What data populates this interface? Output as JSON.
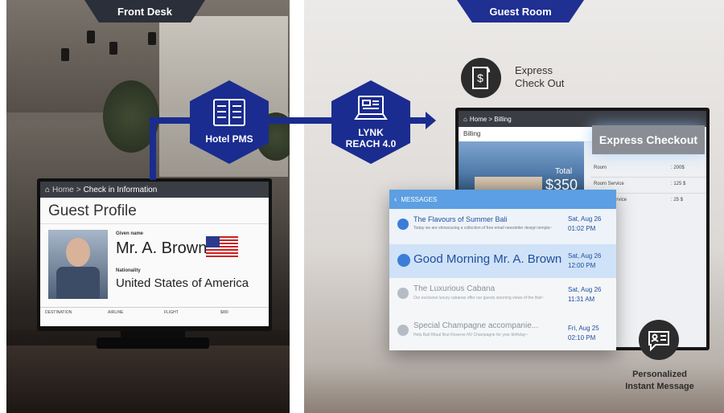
{
  "headers": {
    "front_desk": "Front Desk",
    "guest_room": "Guest Room"
  },
  "hexagons": {
    "hotel_pms": "Hotel PMS",
    "lynk_line1": "LYNK",
    "lynk_line2": "REACH 4.0",
    "pms_icon": "server-icon",
    "lynk_icon": "laptop-icon"
  },
  "front_desk_screen": {
    "breadcrumb_home": "Home",
    "breadcrumb_sep": ">",
    "breadcrumb_page": "Check in Information",
    "title": "Guest Profile",
    "given_name_label": "Given name",
    "given_name": "Mr. A. Brown",
    "nationality_label": "Nationality",
    "nationality": "United States of America",
    "table_headers": [
      "DESTINATION",
      "AIRLINE",
      "FLIGHT",
      "$/80"
    ]
  },
  "features": {
    "express_line1": "Express",
    "express_line2": "Check Out",
    "express_icon": "receipt-dollar-icon",
    "message_line1": "Personalized",
    "message_line2": "Instant Message",
    "message_icon": "chat-person-icon"
  },
  "billing_screen": {
    "breadcrumb": "Home > Billing",
    "tab": "Billing",
    "panel_title": "Express Checkout",
    "total_label": "Total",
    "total_value": "$350",
    "rows": [
      {
        "label": "Room",
        "value": ": 200$"
      },
      {
        "label": "Room Service",
        "value": ": 125 $"
      },
      {
        "label": "service",
        "value": ": 25 $"
      }
    ]
  },
  "messages_panel": {
    "header": "MESSAGES",
    "items": [
      {
        "title": "The Flavours of Summer Bali",
        "preview": "Today we are showcasing a collection of free email newsletter design templa~",
        "date": "Sat, Aug 26",
        "time": "01:02 PM",
        "state": "unread"
      },
      {
        "title": "Good Morning Mr. A. Brown",
        "preview": "",
        "date": "Sat, Aug 26",
        "time": "12:00 PM",
        "state": "selected"
      },
      {
        "title": "The Luxurious Cabana",
        "preview": "Our exclusive luxury cabanas offer our guests stunning views of the Bali~",
        "date": "Sat, Aug 26",
        "time": "11:31 AM",
        "state": "read"
      },
      {
        "title": "Special Champagne accompanie...",
        "preview": "Help Bali Ritual Brut Reserve NV Champagne for your birthday~",
        "date": "Fri, Aug 25",
        "time": "02:10 PM",
        "state": "read"
      }
    ]
  },
  "colors": {
    "brand_blue": "#1a2c8f",
    "accent_blue": "#3b7dd8",
    "selected_row": "#cfe2f7",
    "header_dark": "#2a2f3a"
  }
}
